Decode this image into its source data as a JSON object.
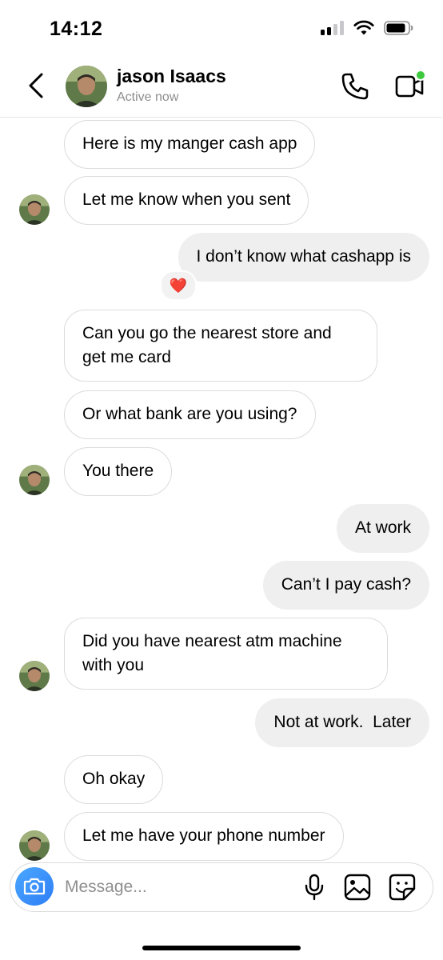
{
  "status_bar": {
    "time": "14:12"
  },
  "header": {
    "contact_name": "jason Isaacs",
    "contact_status": "Active now",
    "online_indicator_color": "#3ec93e"
  },
  "messages": [
    {
      "direction": "in",
      "text": "Here is my manger cash app"
    },
    {
      "direction": "in",
      "text": "Let me know when you sent"
    },
    {
      "direction": "out",
      "text": "I don’t know what cashapp is",
      "reaction": "❤️"
    },
    {
      "direction": "in",
      "text": "Can you go the nearest store and get me card"
    },
    {
      "direction": "in",
      "text": "Or what bank are you using?"
    },
    {
      "direction": "in",
      "text": "You there"
    },
    {
      "direction": "out",
      "text": "At work"
    },
    {
      "direction": "out",
      "text": "Can’t I pay cash?"
    },
    {
      "direction": "in",
      "text": "Did you have nearest atm machine with you"
    },
    {
      "direction": "out",
      "text": "Not at work.  Later"
    },
    {
      "direction": "in",
      "text": "Oh okay"
    },
    {
      "direction": "in",
      "text": "Let me have your phone number"
    }
  ],
  "composer": {
    "placeholder": "Message..."
  },
  "colors": {
    "incoming_bubble_border": "#dbdbdb",
    "outgoing_bubble_bg": "#efefef",
    "camera_button": "#3a8ff8",
    "secondary_text": "#8e8e8e"
  }
}
